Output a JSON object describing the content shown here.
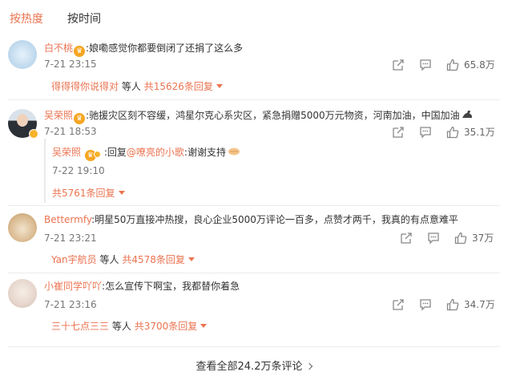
{
  "tabs": [
    {
      "label": "按热度"
    },
    {
      "label": "按时间"
    }
  ],
  "colors": {
    "accent": "#eb7350",
    "text": "#333333",
    "muted": "#777777"
  },
  "comments": [
    {
      "user": "白不桃",
      "separator": ":",
      "text": "娘嘞感觉你都要倒闭了还捐了这么多",
      "time": "7-21 23:15",
      "likes": "65.8万",
      "reply_user": "得得得你说得对",
      "reply_mid": "等人",
      "reply_count": "共15626条回复"
    },
    {
      "user": "吴荣照",
      "separator": ":",
      "text": "驰援灾区刻不容缓，鸿星尔克心系灾区，紧急捐赠5000万元物资，河南加油，中国加油",
      "time": "7-21 18:53",
      "likes": "35.1万",
      "sub_reply": {
        "user": "吴荣照",
        "reply_word": ":回复",
        "mention": "@嘹亮的小歌",
        "text": ":谢谢支持",
        "time": "7-22 19:10"
      },
      "reply_count": "共5761条回复"
    },
    {
      "user": "Bettermfy",
      "separator": ":",
      "text": "明星50万直接冲热搜，良心企业5000万评论一百多，点赞才两千，我真的有点意难平",
      "time": "7-21 23:21",
      "likes": "37万",
      "reply_user": "Yan宇航员",
      "reply_mid": "等人",
      "reply_count": "共4578条回复"
    },
    {
      "user": "小崔同学吖吖",
      "separator": ":",
      "text": "怎么宣传下啊宝，我都替你着急",
      "time": "7-21 23:16",
      "likes": "34.7万",
      "reply_user": "三十七点三三",
      "reply_mid": "等人",
      "reply_count": "共3700条回复"
    }
  ],
  "footer": {
    "label": "查看全部24.2万条评论"
  },
  "icons": {
    "share": "share-icon",
    "comment": "comment-icon",
    "like": "thumbs-up-icon"
  }
}
